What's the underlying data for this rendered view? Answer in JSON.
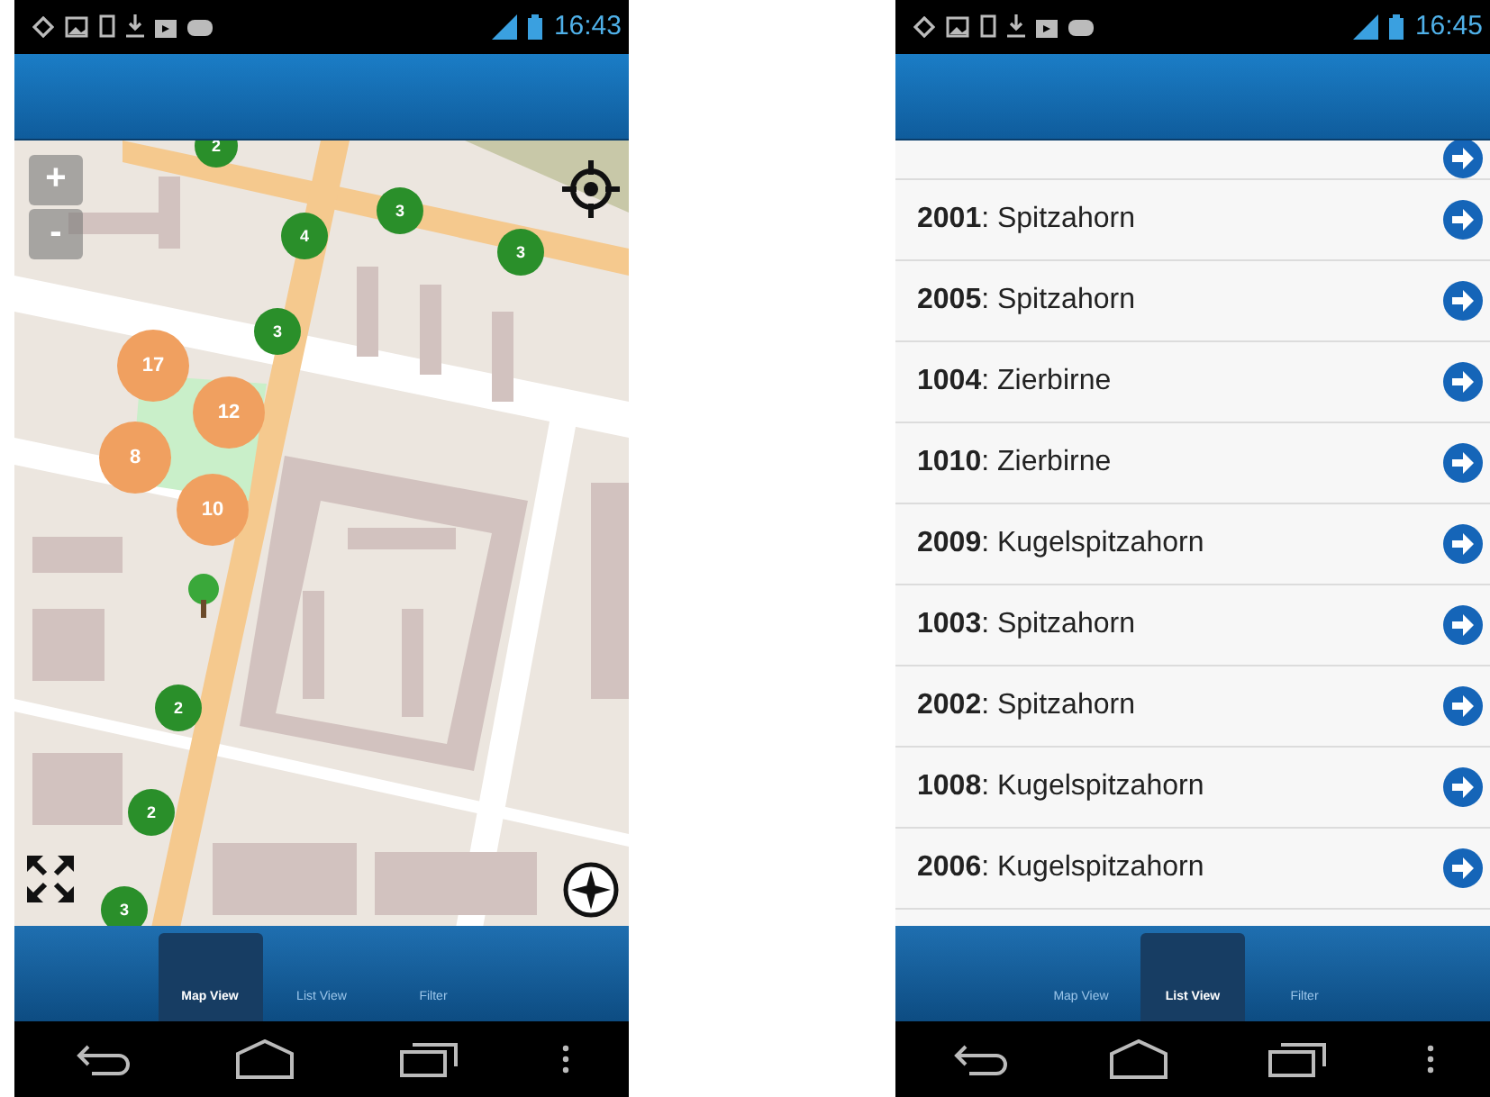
{
  "phones": [
    {
      "status_bar": {
        "time": "16:43"
      },
      "screen": {
        "kind": "map",
        "zoom_in": "+",
        "zoom_out": "-",
        "markers": [
          {
            "label": "2",
            "color": "#2a8f2a"
          },
          {
            "label": "4",
            "color": "#2a8f2a"
          },
          {
            "label": "3",
            "color": "#2a8f2a"
          },
          {
            "label": "3",
            "color": "#2a8f2a"
          },
          {
            "label": "3",
            "color": "#2a8f2a"
          },
          {
            "label": "17",
            "color": "#f0a060"
          },
          {
            "label": "12",
            "color": "#f0a060"
          },
          {
            "label": "8",
            "color": "#f0a060"
          },
          {
            "label": "10",
            "color": "#f0a060"
          },
          {
            "label": "2",
            "color": "#2a8f2a"
          },
          {
            "label": "2",
            "color": "#2a8f2a"
          },
          {
            "label": "3",
            "color": "#2a8f2a"
          }
        ]
      },
      "tabs": [
        {
          "label": "Map View",
          "selected": true
        },
        {
          "label": "List View",
          "selected": false
        },
        {
          "label": "Filter",
          "selected": false
        }
      ]
    },
    {
      "status_bar": {
        "time": "16:45"
      },
      "screen": {
        "kind": "list",
        "rows": [
          {
            "text": "**2001**: Spitzahorn"
          },
          {
            "text": "**2005**: Spitzahorn"
          },
          {
            "text": "**1004**: Zierbirne"
          },
          {
            "text": "**1010**: Zierbirne"
          },
          {
            "text": "**2009**: Kugelspitzahorn"
          },
          {
            "text": "**1003**: Spitzahorn"
          },
          {
            "text": "**2002**: Spitzahorn"
          },
          {
            "text": "**1008**: Kugelspitzahorn"
          },
          {
            "text": "**2006**: Kugelspitzahorn"
          }
        ]
      },
      "tabs": [
        {
          "label": "Map View",
          "selected": false
        },
        {
          "label": "List View",
          "selected": true
        },
        {
          "label": "Filter",
          "selected": false
        }
      ]
    }
  ]
}
